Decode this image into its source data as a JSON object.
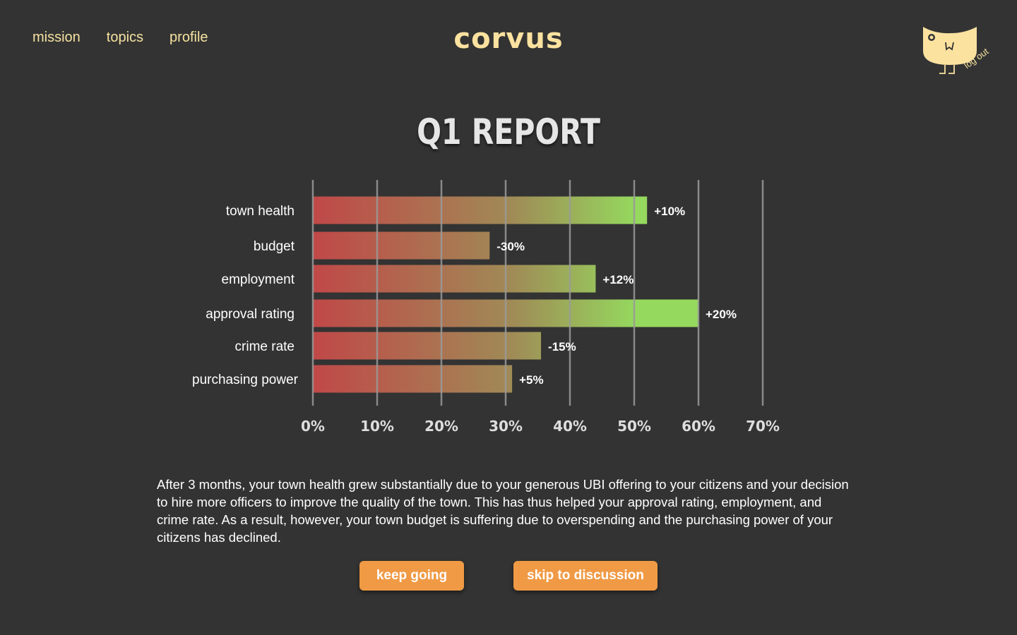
{
  "nav": {
    "items": [
      {
        "label": "mission"
      },
      {
        "label": "topics"
      },
      {
        "label": "profile"
      }
    ]
  },
  "brand": {
    "name": "corvus"
  },
  "account": {
    "logout_label": "log out",
    "mascot_icon": "crow-mascot-icon"
  },
  "colors": {
    "background": "#333333",
    "nav_text": "#f5e2a0",
    "brand": "#fbe29f",
    "bar_low": "#c04848",
    "bar_high": "#95d95e",
    "button": "#f09a45"
  },
  "chart_data": {
    "type": "bar",
    "orientation": "horizontal",
    "title": "Q1 REPORT",
    "categories": [
      "town health",
      "budget",
      "employment",
      "approval rating",
      "crime rate",
      "purchasing power"
    ],
    "values": [
      52,
      27.5,
      44,
      60,
      35.5,
      31
    ],
    "data_labels": [
      "+10%",
      "-30%",
      "+12%",
      "+20%",
      "-15%",
      "+5%"
    ],
    "x_ticks": [
      "0%",
      "10%",
      "20%",
      "30%",
      "40%",
      "50%",
      "60%",
      "70%"
    ],
    "xlim": [
      0,
      70
    ],
    "grid": true
  },
  "summary": {
    "text": "After 3 months, your town health grew substantially due to your generous UBI offering to your citizens and your decision to hire more officers to improve the quality of the town. This has thus helped your approval rating, employment, and crime rate. As a result, however, your town budget is suffering due to overspending and the purchasing power of your citizens has declined."
  },
  "actions": {
    "keep_label": "keep going",
    "skip_label": "skip to discussion"
  }
}
